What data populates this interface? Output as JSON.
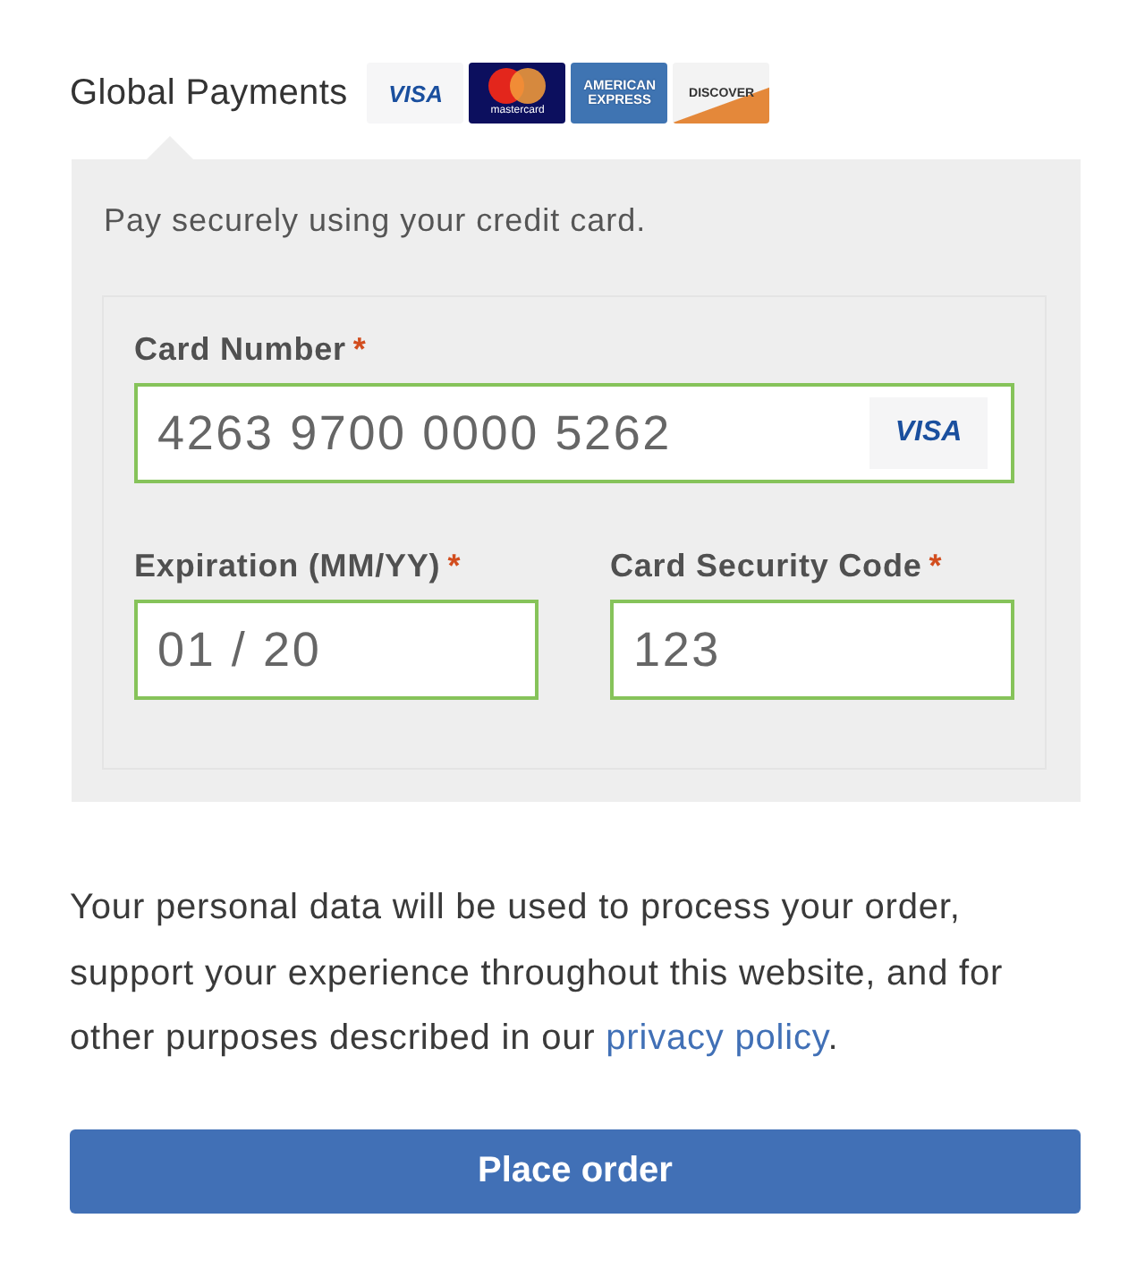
{
  "gateway": {
    "title": "Global Payments",
    "card_logos": [
      {
        "kind": "visa",
        "text": "VISA"
      },
      {
        "kind": "mastercard",
        "text": "mastercard"
      },
      {
        "kind": "amex",
        "text": "AMERICAN EXPRESS"
      },
      {
        "kind": "discover",
        "text": "DISCOVER"
      }
    ]
  },
  "panel": {
    "description": "Pay securely using your credit card.",
    "fields": [
      {
        "label": "Card Number",
        "required_mark": "*",
        "value": "4263 9700 0000 5262",
        "valid": true,
        "brand": {
          "kind": "visa",
          "text": "VISA"
        }
      },
      {
        "label": "Expiration (MM/YY)",
        "required_mark": "*",
        "value": "01 / 20",
        "valid": true
      },
      {
        "label": "Card Security Code",
        "required_mark": "*",
        "value": "123",
        "valid": true
      }
    ]
  },
  "privacy_notice": {
    "text": "Your personal data will be used to process your order, support your experience throughout this website, and for other purposes described in our ",
    "link": "privacy policy",
    "after": "."
  },
  "place_order_button": {
    "label": "Place order"
  }
}
